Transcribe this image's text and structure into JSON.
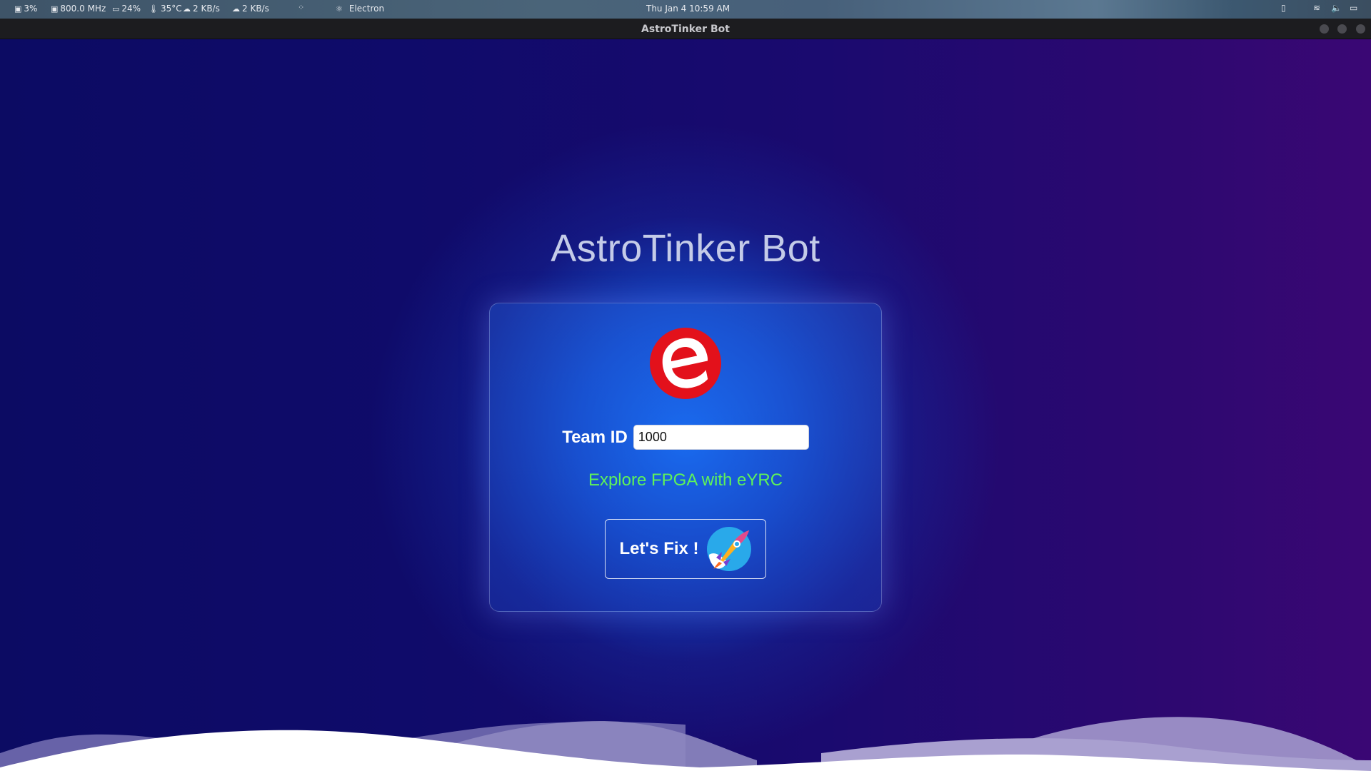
{
  "system_bar": {
    "cpu": "3%",
    "freq": "800.0 MHz",
    "mem": "24%",
    "temp": "35°C",
    "net_down": "2 KB/s",
    "net_up": "2 KB/s",
    "app_name": "Electron",
    "clock": "Thu Jan 4  10:59 AM"
  },
  "window": {
    "title": "AstroTinker Bot"
  },
  "app": {
    "title": "AstroTinker Bot",
    "team_label": "Team ID",
    "team_value": "1000",
    "tagline": "Explore FPGA with eYRC",
    "button_label": "Let's Fix !"
  },
  "colors": {
    "tagline": "#5ef25a",
    "logo_red": "#e3111b",
    "bg_deep": "#0c0b63",
    "glow_blue": "#1478ff"
  }
}
